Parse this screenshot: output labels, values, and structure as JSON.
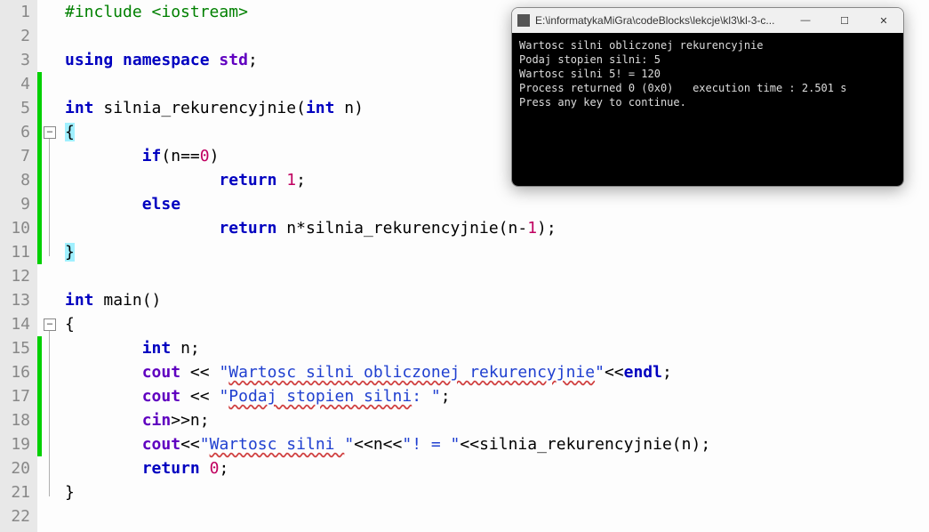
{
  "editor": {
    "lines": [
      [
        {
          "cls": "pp",
          "t": "#include <iostream>"
        }
      ],
      [],
      [
        {
          "cls": "kw",
          "t": "using"
        },
        {
          "t": " "
        },
        {
          "cls": "kw",
          "t": "namespace"
        },
        {
          "t": " "
        },
        {
          "cls": "tp",
          "t": "std"
        },
        {
          "t": ";"
        }
      ],
      [],
      [
        {
          "cls": "kw",
          "t": "int"
        },
        {
          "t": " silnia_rekurencyjnie("
        },
        {
          "cls": "kw",
          "t": "int"
        },
        {
          "t": " n)"
        }
      ],
      [
        {
          "cls": "bh",
          "t": "{"
        }
      ],
      [
        {
          "t": "    "
        },
        {
          "cls": "kw",
          "t": "if"
        },
        {
          "t": "(n=="
        },
        {
          "cls": "num",
          "t": "0"
        },
        {
          "t": ")"
        }
      ],
      [
        {
          "t": "        "
        },
        {
          "cls": "kw",
          "t": "return"
        },
        {
          "t": " "
        },
        {
          "cls": "num",
          "t": "1"
        },
        {
          "t": ";"
        }
      ],
      [
        {
          "t": "    "
        },
        {
          "cls": "kw",
          "t": "else"
        }
      ],
      [
        {
          "t": "        "
        },
        {
          "cls": "kw",
          "t": "return"
        },
        {
          "t": " n*silnia_rekurencyjnie(n-"
        },
        {
          "cls": "num",
          "t": "1"
        },
        {
          "t": ");"
        }
      ],
      [
        {
          "cls": "bh",
          "t": "}"
        }
      ],
      [],
      [
        {
          "cls": "kw",
          "t": "int"
        },
        {
          "t": " main()"
        }
      ],
      [
        {
          "t": "{"
        }
      ],
      [
        {
          "t": "    "
        },
        {
          "cls": "kw",
          "t": "int"
        },
        {
          "t": " n;"
        }
      ],
      [
        {
          "t": "    "
        },
        {
          "cls": "tp",
          "t": "cout"
        },
        {
          "t": " << "
        },
        {
          "cls": "str",
          "t": "\""
        },
        {
          "cls": "ustr",
          "t": "Wartosc silni obliczonej rekurencyjnie"
        },
        {
          "cls": "str",
          "t": "\""
        },
        {
          "t": "<<"
        },
        {
          "cls": "kw",
          "t": "endl"
        },
        {
          "t": ";"
        }
      ],
      [
        {
          "t": "    "
        },
        {
          "cls": "tp",
          "t": "cout"
        },
        {
          "t": " << "
        },
        {
          "cls": "str",
          "t": "\""
        },
        {
          "cls": "ustr",
          "t": "Podaj stopien silni"
        },
        {
          "cls": "str",
          "t": ": \""
        },
        {
          "t": ";"
        }
      ],
      [
        {
          "t": "    "
        },
        {
          "cls": "tp",
          "t": "cin"
        },
        {
          "t": ">>n;"
        }
      ],
      [
        {
          "t": "    "
        },
        {
          "cls": "tp",
          "t": "cout"
        },
        {
          "t": "<<"
        },
        {
          "cls": "str",
          "t": "\""
        },
        {
          "cls": "ustr",
          "t": "Wartosc silni "
        },
        {
          "cls": "str",
          "t": "\""
        },
        {
          "t": "<<n<<"
        },
        {
          "cls": "str",
          "t": "\"! = \""
        },
        {
          "t": "<<silnia_rekurencyjnie(n);"
        }
      ],
      [
        {
          "t": "    "
        },
        {
          "cls": "kw",
          "t": "return"
        },
        {
          "t": " "
        },
        {
          "cls": "num",
          "t": "0"
        },
        {
          "t": ";"
        }
      ],
      [
        {
          "t": "}"
        }
      ],
      []
    ],
    "indent": {
      "1": 0,
      "2": 0,
      "3": 0,
      "4": 0,
      "5": 0,
      "6": 0,
      "7": 1,
      "8": 2,
      "9": 1,
      "10": 2,
      "11": 0,
      "12": 0,
      "13": 0,
      "14": 0,
      "15": 1,
      "16": 1,
      "17": 1,
      "18": 1,
      "19": 1,
      "20": 1,
      "21": 0,
      "22": 0
    },
    "change_marks": [
      {
        "from": 4,
        "to": 11
      },
      {
        "from": 15,
        "to": 19
      }
    ],
    "fold_boxes": [
      6,
      14
    ],
    "fold_lines": [
      {
        "from": 6,
        "to": 11
      },
      {
        "from": 14,
        "to": 21
      }
    ]
  },
  "terminal": {
    "title": "E:\\informatykaMiGra\\codeBlocks\\lekcje\\kl3\\kl-3-c...",
    "lines": [
      "Wartosc silni obliczonej rekurencyjnie",
      "Podaj stopien silni: 5",
      "Wartosc silni 5! = 120",
      "Process returned 0 (0x0)   execution time : 2.501 s",
      "Press any key to continue."
    ],
    "buttons": {
      "min": "—",
      "max": "☐",
      "close": "✕"
    }
  }
}
